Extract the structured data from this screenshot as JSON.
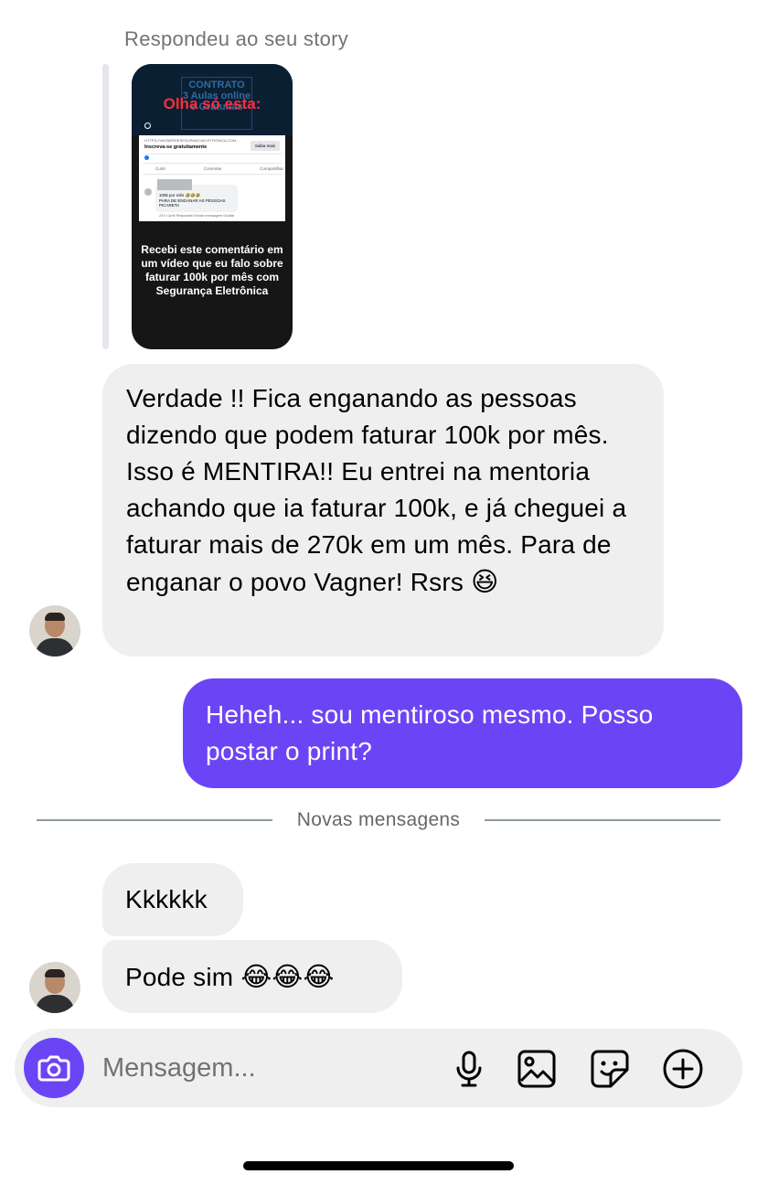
{
  "story_reply": {
    "label": "Respondeu ao seu story",
    "preview": {
      "background_text": "CONTRATO",
      "background_subtext": "3 Aulas online e Gratuitas",
      "headline": "Olha só esta:",
      "post_url": "HTTPS://VAGNERDESEGURANCAELETRONICA.COM...",
      "post_cta": "Inscreva-se gratuitamente",
      "post_button": "Saiba mais",
      "post_actions": [
        "Curtir",
        "Comentar",
        "Compartilhar"
      ],
      "comment_text": "100k por mês 🤣🤣🤣\nPARA DE ENGANAR AS PESSOAS\nPICARETA",
      "comment_meta": "23 h   Curtir   Responder   Enviar mensagem   Ocultar",
      "caption": "Recebi este comentário em um vídeo que eu falo sobre faturar 100k por mês com Segurança Eletrônica"
    }
  },
  "messages": [
    {
      "direction": "incoming",
      "text": "Verdade !! Fica enganando as pessoas dizendo que podem faturar 100k por mês. Isso é MENTIRA!! Eu entrei na mentoria achando que ia faturar 100k, e já cheguei a faturar mais de 270k em um mês. Para de enganar o povo Vagner! Rsrs",
      "emoji": "😆"
    },
    {
      "direction": "outgoing",
      "text": "Heheh... sou mentiroso mesmo. Posso postar o print?"
    },
    {
      "direction": "incoming",
      "text": "Kkkkkk"
    },
    {
      "direction": "incoming",
      "text": "Pode sim",
      "emoji": "😂😂😂"
    }
  ],
  "divider": {
    "label": "Novas mensagens"
  },
  "composer": {
    "placeholder": "Mensagem...",
    "icons": [
      "camera-icon",
      "microphone-icon",
      "image-icon",
      "sticker-icon",
      "plus-icon"
    ]
  },
  "colors": {
    "accent": "#6b45f5",
    "incoming_bubble": "#efefef",
    "muted_text": "#737373"
  }
}
